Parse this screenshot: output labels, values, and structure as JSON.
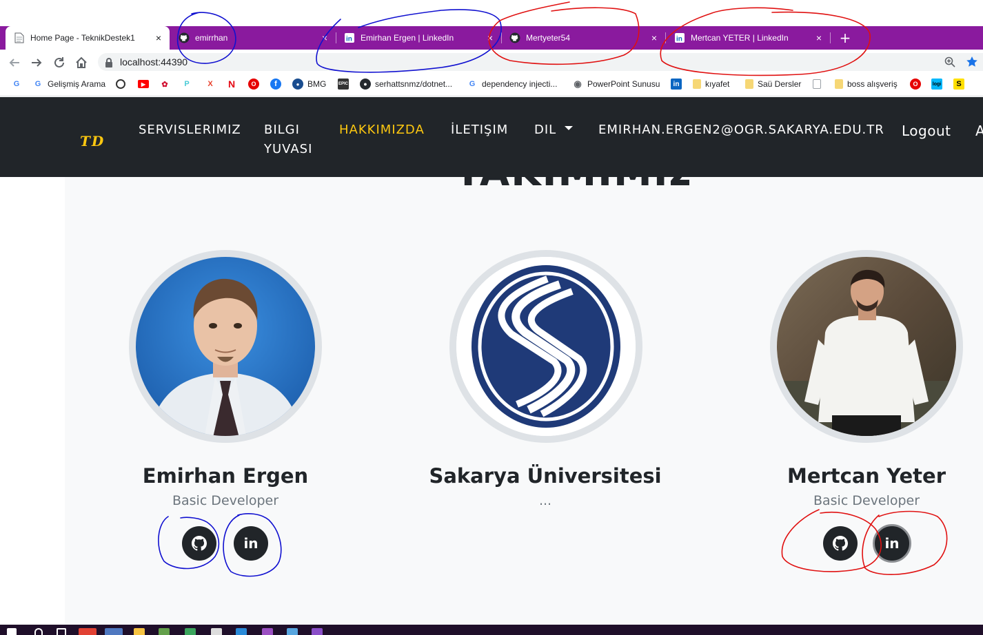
{
  "browser": {
    "tabs": [
      {
        "title": "Home Page - TeknikDestek1",
        "active": true,
        "icon": "page-icon"
      },
      {
        "title": "emirrhan",
        "active": false,
        "icon": "github-icon"
      },
      {
        "title": "Emirhan Ergen | LinkedIn",
        "active": false,
        "icon": "linkedin-icon"
      },
      {
        "title": "Mertyeter54",
        "active": false,
        "icon": "github-icon"
      },
      {
        "title": "Mertcan YETER | LinkedIn",
        "active": false,
        "icon": "linkedin-icon"
      }
    ],
    "close_glyph": "×",
    "new_tab_glyph": "+",
    "url": "localhost:44390",
    "bookmarks": [
      {
        "label": "",
        "icon": "google-icon"
      },
      {
        "label": "Gelişmiş Arama",
        "icon": "google-icon"
      },
      {
        "label": "",
        "icon": "speedometer-icon"
      },
      {
        "label": "",
        "icon": "youtube-icon"
      },
      {
        "label": "",
        "icon": "huawei-icon"
      },
      {
        "label": "",
        "icon": "tplink-icon"
      },
      {
        "label": "",
        "icon": "x-icon"
      },
      {
        "label": "",
        "icon": "netflix-icon"
      },
      {
        "label": "",
        "icon": "vodafone-icon"
      },
      {
        "label": "",
        "icon": "facebook-icon"
      },
      {
        "label": "BMG",
        "icon": "bmg-icon"
      },
      {
        "label": "",
        "icon": "epic-icon"
      },
      {
        "label": "serhattsnmz/dotnet...",
        "icon": "github-icon"
      },
      {
        "label": "dependency injecti...",
        "icon": "google-icon"
      },
      {
        "label": "PowerPoint Sunusu",
        "icon": "globe-icon"
      },
      {
        "label": "",
        "icon": "linkedin-icon"
      },
      {
        "label": "kıyafet",
        "icon": "folder-icon"
      },
      {
        "label": "Saü Dersler",
        "icon": "folder-icon"
      },
      {
        "label": "",
        "icon": "page-icon"
      },
      {
        "label": "boss alışveriş",
        "icon": "folder-icon"
      },
      {
        "label": "",
        "icon": "vodafone-icon"
      },
      {
        "label": "logi",
        "icon": "logi-icon"
      },
      {
        "label": "S",
        "icon": "s-icon"
      }
    ]
  },
  "site": {
    "brand": "TD",
    "nav": {
      "services": "SERVISLERIMIZ",
      "knowledge_line1": "BILGI",
      "knowledge_line2": "YUVASI",
      "about": "HAKKIMIZDA",
      "contact": "İLETIŞIM",
      "language": "DIL",
      "email": "EMIRHAN.ERGEN2@OGR.SAKARYA.EDU.TR",
      "logout": "Logout",
      "cut_off": "A"
    },
    "section_title": "TAKIMIMIZ",
    "members": [
      {
        "name": "Emirhan Ergen",
        "role": "Basic Developer",
        "github": "github-icon",
        "linkedin": "in"
      },
      {
        "name": "Sakarya Üniversitesi",
        "role": "..."
      },
      {
        "name": "Mertcan Yeter",
        "role": "Basic Developer",
        "github": "github-icon",
        "linkedin": "in"
      }
    ]
  },
  "colors": {
    "tab_strip": "#8a1a9e",
    "navbar": "#212529",
    "accent": "#fec810",
    "content_bg": "#f8f9fa",
    "avatar_border": "#dee2e6",
    "sakarya_blue": "#1f3a78",
    "annotation_blue": "#1010d0",
    "annotation_red": "#e01010"
  }
}
